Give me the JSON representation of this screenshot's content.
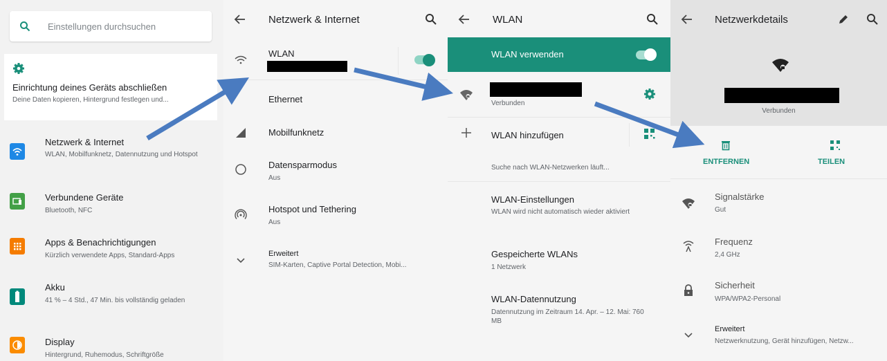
{
  "colors": {
    "accent": "#1a8f7a",
    "arrow": "#4a7bc0"
  },
  "settings": {
    "search_placeholder": "Einstellungen durchsuchen",
    "setup_title": "Einrichtung deines Geräts abschließen",
    "setup_sub": "Deine Daten kopieren, Hintergrund festlegen und...",
    "items": [
      {
        "title": "Netzwerk & Internet",
        "sub": "WLAN, Mobilfunknetz, Datennutzung und Hotspot",
        "icon": "wifi-icon",
        "color": "#1e88e5"
      },
      {
        "title": "Verbundene Geräte",
        "sub": "Bluetooth, NFC",
        "icon": "devices-icon",
        "color": "#43a047"
      },
      {
        "title": "Apps & Benachrichtigungen",
        "sub": "Kürzlich verwendete Apps, Standard-Apps",
        "icon": "apps-icon",
        "color": "#f57c00"
      },
      {
        "title": "Akku",
        "sub": "41 % – 4 Std., 47 Min. bis vollständig geladen",
        "icon": "battery-icon",
        "color": "#00897b"
      },
      {
        "title": "Display",
        "sub": "Hintergrund, Ruhemodus, Schriftgröße",
        "icon": "brightness-icon",
        "color": "#fb8c00"
      }
    ]
  },
  "network": {
    "title": "Netzwerk & Internet",
    "wlan": "WLAN",
    "ethernet": "Ethernet",
    "mobile": "Mobilfunknetz",
    "datasaver": "Datensparmodus",
    "datasaver_sub": "Aus",
    "hotspot": "Hotspot und Tethering",
    "hotspot_sub": "Aus",
    "advanced": "Erweitert",
    "advanced_sub": "SIM-Karten, Captive Portal Detection, Mobi..."
  },
  "wlan": {
    "title": "WLAN",
    "use_wlan": "WLAN verwenden",
    "connected": "Verbunden",
    "add": "WLAN hinzufügen",
    "searching": "Suche nach WLAN-Netzwerken läuft...",
    "settings": "WLAN-Einstellungen",
    "settings_sub": "WLAN wird nicht automatisch wieder aktiviert",
    "saved": "Gespeicherte WLANs",
    "saved_sub": "1 Netzwerk",
    "usage": "WLAN-Datennutzung",
    "usage_sub": "Datennutzung im Zeitraum 14. Apr. – 12. Mai: 760 MB"
  },
  "details": {
    "title": "Netzwerkdetails",
    "connected": "Verbunden",
    "remove": "ENTFERNEN",
    "share": "TEILEN",
    "signal": "Signalstärke",
    "signal_val": "Gut",
    "freq": "Frequenz",
    "freq_val": "2,4 GHz",
    "security": "Sicherheit",
    "security_val": "WPA/WPA2-Personal",
    "advanced": "Erweitert",
    "advanced_sub": "Netzwerknutzung, Gerät hinzufügen, Netzw..."
  }
}
